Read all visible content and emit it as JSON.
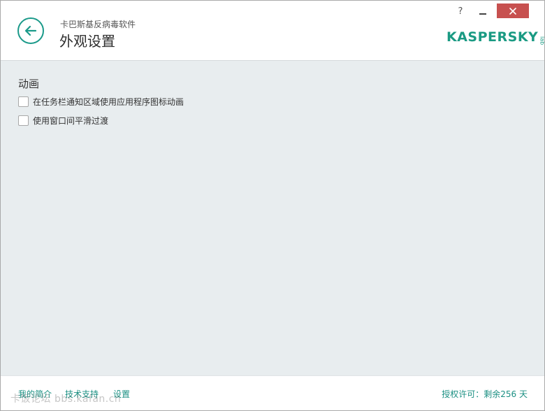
{
  "header": {
    "app_name": "卡巴斯基反病毒软件",
    "page_title": "外观设置",
    "help_label": "?",
    "logo_text": "KASPERSKY",
    "logo_lab": "lab"
  },
  "main": {
    "section_title": "动画",
    "options": [
      {
        "label": "在任务栏通知区域使用应用程序图标动画",
        "checked": false
      },
      {
        "label": "使用窗口间平滑过渡",
        "checked": false
      }
    ]
  },
  "footer": {
    "links": [
      "我的简介",
      "技术支持",
      "设置"
    ],
    "license": "授权许可：剩余256 天",
    "watermark": "卡饭论坛 bbs.kafan.cn"
  },
  "colors": {
    "accent": "#1a9a83",
    "close": "#c7504f",
    "content_bg": "#e8edef"
  }
}
